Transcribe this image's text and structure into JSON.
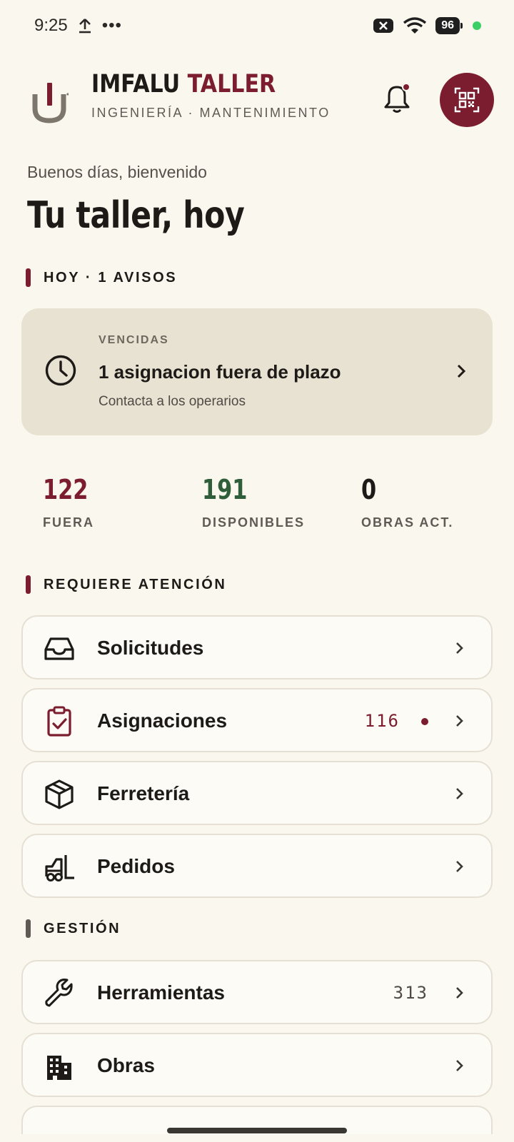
{
  "status_bar": {
    "time": "9:25",
    "battery": "96"
  },
  "header": {
    "brand_main": "IMFALU",
    "brand_accent": "TALLER",
    "subtitle": "INGENIERÍA · MANTENIMIENTO"
  },
  "greeting": "Buenos días, bienvenido",
  "page_title": "Tu taller, hoy",
  "sections": {
    "today": "HOY · 1 AVISOS",
    "attention": "REQUIERE ATENCIÓN",
    "management": "GESTIÓN"
  },
  "alert": {
    "kicker": "VENCIDAS",
    "title": "1 asignacion fuera de plazo",
    "subtitle": "Contacta a los operarios"
  },
  "stats": [
    {
      "value": "122",
      "label": "FUERA",
      "color": "#7b1d2f"
    },
    {
      "value": "191",
      "label": "DISPONIBLES",
      "color": "#2f5f3a"
    },
    {
      "value": "0",
      "label": "OBRAS ACT.",
      "color": "#1d1a17"
    }
  ],
  "attention_items": [
    {
      "label": "Solicitudes",
      "icon": "inbox-icon"
    },
    {
      "label": "Asignaciones",
      "icon": "clipboard-check-icon",
      "count": "116"
    },
    {
      "label": "Ferretería",
      "icon": "package-icon"
    },
    {
      "label": "Pedidos",
      "icon": "forklift-icon"
    }
  ],
  "management_items": [
    {
      "label": "Herramientas",
      "icon": "wrench-icon",
      "count": "313"
    },
    {
      "label": "Obras",
      "icon": "buildings-icon"
    }
  ],
  "colors": {
    "accent": "#7b1d2f",
    "background": "#faf7ef",
    "alert_bg": "#e8e2d2"
  }
}
